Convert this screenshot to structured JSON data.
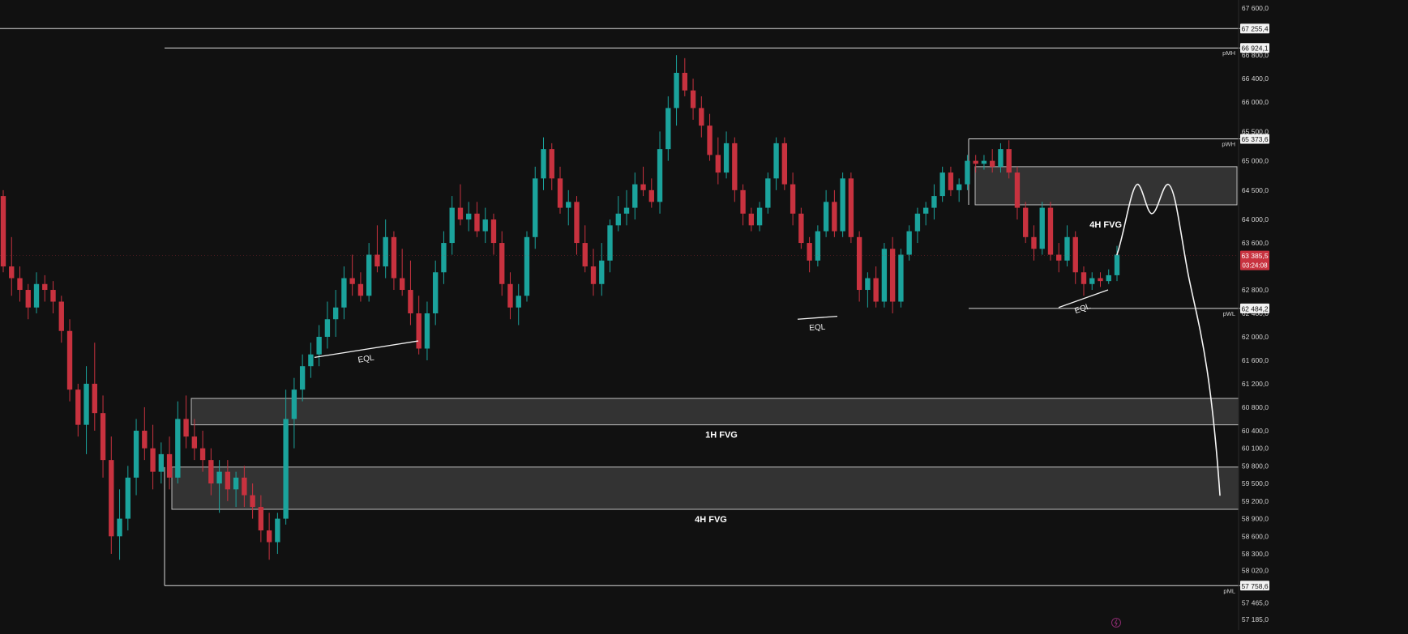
{
  "chart_data": {
    "type": "candlestick",
    "y_scale": "linear",
    "ylim": [
      57000,
      67800
    ],
    "grid": false,
    "legend": "none",
    "colors": {
      "background": "#111111",
      "up": "#1ba39c",
      "down": "#c8323f",
      "zone_fill": "#3a3a3a",
      "line": "#d8d8d8",
      "current_price": "#c8323f"
    },
    "y_ticks": [
      "67 600,0",
      "66 800,0",
      "66 400,0",
      "66 000,0",
      "65 500,0",
      "65 000,0",
      "64 500,0",
      "64 000,0",
      "63 600,0",
      "63 200,0",
      "62 800,0",
      "62 400,0",
      "62 000,0",
      "61 600,0",
      "61 200,0",
      "60 800,0",
      "60 400,0",
      "60 100,0",
      "59 800,0",
      "59 500,0",
      "59 200,0",
      "58 900,0",
      "58 600,0",
      "58 300,0",
      "58 020,0",
      "57 465,0",
      "57 185,0"
    ],
    "key_levels": [
      {
        "label": "",
        "price": 67255.4,
        "price_label": "67 255,4"
      },
      {
        "label": "pMH",
        "price": 66924.1,
        "price_label": "66 924,1"
      },
      {
        "label": "pWH",
        "price": 65373.6,
        "price_label": "65 373,6"
      },
      {
        "label": "pWL",
        "price": 62484.2,
        "price_label": "62 484,2"
      },
      {
        "label": "pML",
        "price": 57758.6,
        "price_label": "57 758,6"
      }
    ],
    "current_price": {
      "price": 63385.5,
      "price_label": "63 385,5",
      "countdown": "03:24:08"
    },
    "zones": [
      {
        "label": "4H FVG",
        "top": 64900,
        "bottom": 64250
      },
      {
        "label": "1H FVG",
        "top": 60950,
        "bottom": 60500
      },
      {
        "label": "4H FVG",
        "top": 59780,
        "bottom": 59060
      }
    ],
    "equal_lows": [
      {
        "label": "EQL",
        "from": 61650,
        "to": 61930
      },
      {
        "label": "EQL",
        "from": 62300,
        "to": 62350
      },
      {
        "label": "EQL",
        "from": 62500,
        "to": 62800
      }
    ],
    "candles": [
      [
        64400,
        64500,
        63100,
        63200
      ],
      [
        63200,
        63700,
        62700,
        63000
      ],
      [
        63000,
        63200,
        62600,
        62800
      ],
      [
        62800,
        62900,
        62300,
        62500
      ],
      [
        62500,
        63100,
        62400,
        62900
      ],
      [
        62900,
        63050,
        62600,
        62800
      ],
      [
        62800,
        62950,
        62400,
        62600
      ],
      [
        62600,
        62700,
        61900,
        62100
      ],
      [
        62100,
        62300,
        60900,
        61100
      ],
      [
        61100,
        61200,
        60300,
        60500
      ],
      [
        60500,
        61500,
        60000,
        61200
      ],
      [
        61200,
        61900,
        60400,
        60700
      ],
      [
        60700,
        61000,
        59600,
        59900
      ],
      [
        59900,
        60300,
        58300,
        58600
      ],
      [
        58600,
        59400,
        58200,
        58900
      ],
      [
        58900,
        59800,
        58700,
        59600
      ],
      [
        59600,
        60600,
        59300,
        60400
      ],
      [
        60400,
        60800,
        59900,
        60100
      ],
      [
        60100,
        60500,
        59400,
        59700
      ],
      [
        59700,
        60200,
        59500,
        60000
      ],
      [
        60000,
        60300,
        59400,
        59600
      ],
      [
        59600,
        60900,
        59500,
        60600
      ],
      [
        60600,
        61000,
        60100,
        60300
      ],
      [
        60300,
        60600,
        59900,
        60100
      ],
      [
        60100,
        60400,
        59700,
        59900
      ],
      [
        59900,
        60100,
        59300,
        59500
      ],
      [
        59500,
        59900,
        59000,
        59700
      ],
      [
        59700,
        59900,
        59200,
        59400
      ],
      [
        59400,
        59700,
        59100,
        59600
      ],
      [
        59600,
        59800,
        59100,
        59300
      ],
      [
        59300,
        59500,
        58900,
        59100
      ],
      [
        59100,
        59300,
        58500,
        58700
      ],
      [
        58700,
        59000,
        58200,
        58500
      ],
      [
        58500,
        59000,
        58300,
        58900
      ],
      [
        58900,
        61100,
        58800,
        60600
      ],
      [
        60600,
        61300,
        60100,
        61100
      ],
      [
        61100,
        61700,
        60900,
        61500
      ],
      [
        61500,
        61900,
        61300,
        61700
      ],
      [
        61700,
        62200,
        61500,
        62000
      ],
      [
        62000,
        62600,
        61800,
        62300
      ],
      [
        62300,
        62800,
        62000,
        62500
      ],
      [
        62500,
        63200,
        62300,
        63000
      ],
      [
        63000,
        63400,
        62700,
        62900
      ],
      [
        62900,
        63100,
        62600,
        62700
      ],
      [
        62700,
        63600,
        62600,
        63400
      ],
      [
        63400,
        63900,
        63100,
        63200
      ],
      [
        63200,
        64000,
        63000,
        63700
      ],
      [
        63700,
        63800,
        62800,
        63000
      ],
      [
        63000,
        63500,
        62700,
        62800
      ],
      [
        62800,
        63300,
        62200,
        62400
      ],
      [
        62400,
        62700,
        61700,
        61800
      ],
      [
        61800,
        62600,
        61600,
        62400
      ],
      [
        62400,
        63300,
        62200,
        63100
      ],
      [
        63100,
        63800,
        62900,
        63600
      ],
      [
        63600,
        64400,
        63400,
        64200
      ],
      [
        64200,
        64600,
        63900,
        64000
      ],
      [
        64000,
        64300,
        63800,
        64100
      ],
      [
        64100,
        64300,
        63700,
        63800
      ],
      [
        63800,
        64200,
        63600,
        64000
      ],
      [
        64000,
        64100,
        63400,
        63600
      ],
      [
        63600,
        63800,
        62700,
        62900
      ],
      [
        62900,
        63100,
        62300,
        62500
      ],
      [
        62500,
        62900,
        62200,
        62700
      ],
      [
        62700,
        63800,
        62600,
        63700
      ],
      [
        63700,
        64900,
        63500,
        64700
      ],
      [
        64700,
        65400,
        64500,
        65200
      ],
      [
        65200,
        65300,
        64500,
        64700
      ],
      [
        64700,
        64900,
        64100,
        64200
      ],
      [
        64200,
        64500,
        63900,
        64300
      ],
      [
        64300,
        64400,
        63400,
        63600
      ],
      [
        63600,
        63900,
        63100,
        63200
      ],
      [
        63200,
        63500,
        62700,
        62900
      ],
      [
        62900,
        63600,
        62700,
        63300
      ],
      [
        63300,
        64000,
        63100,
        63900
      ],
      [
        63900,
        64400,
        63800,
        64100
      ],
      [
        64100,
        64500,
        63900,
        64200
      ],
      [
        64200,
        64800,
        64000,
        64600
      ],
      [
        64600,
        64900,
        64400,
        64500
      ],
      [
        64500,
        64700,
        64200,
        64300
      ],
      [
        64300,
        65500,
        64100,
        65200
      ],
      [
        65200,
        66100,
        65000,
        65900
      ],
      [
        65900,
        66800,
        65600,
        66500
      ],
      [
        66500,
        66750,
        66100,
        66200
      ],
      [
        66200,
        66400,
        65700,
        65900
      ],
      [
        65900,
        66100,
        65400,
        65600
      ],
      [
        65600,
        65800,
        65000,
        65100
      ],
      [
        65100,
        65400,
        64600,
        64800
      ],
      [
        64800,
        65500,
        64700,
        65300
      ],
      [
        65300,
        65400,
        64300,
        64500
      ],
      [
        64500,
        64600,
        63900,
        64100
      ],
      [
        64100,
        64200,
        63800,
        63900
      ],
      [
        63900,
        64300,
        63800,
        64200
      ],
      [
        64200,
        64800,
        64100,
        64700
      ],
      [
        64700,
        65400,
        64500,
        65300
      ],
      [
        65300,
        65400,
        64500,
        64600
      ],
      [
        64600,
        64800,
        63900,
        64100
      ],
      [
        64100,
        64200,
        63500,
        63600
      ],
      [
        63600,
        63700,
        63100,
        63300
      ],
      [
        63300,
        63900,
        63200,
        63800
      ],
      [
        63800,
        64500,
        63700,
        64300
      ],
      [
        64300,
        64500,
        63700,
        63800
      ],
      [
        63800,
        64800,
        63700,
        64700
      ],
      [
        64700,
        64800,
        63600,
        63700
      ],
      [
        63700,
        63800,
        62600,
        62800
      ],
      [
        62800,
        63100,
        62500,
        63000
      ],
      [
        63000,
        63200,
        62500,
        62600
      ],
      [
        62600,
        63600,
        62500,
        63500
      ],
      [
        63500,
        63700,
        62400,
        62600
      ],
      [
        62600,
        63500,
        62500,
        63400
      ],
      [
        63400,
        63900,
        63300,
        63800
      ],
      [
        63800,
        64200,
        63600,
        64100
      ],
      [
        64100,
        64300,
        63900,
        64200
      ],
      [
        64200,
        64600,
        64000,
        64400
      ],
      [
        64400,
        64900,
        64300,
        64800
      ],
      [
        64800,
        64900,
        64400,
        64500
      ],
      [
        64500,
        64700,
        64300,
        64600
      ],
      [
        64600,
        65100,
        64500,
        65000
      ],
      [
        65000,
        65100,
        64800,
        64950
      ],
      [
        64950,
        65100,
        64850,
        65000
      ],
      [
        65000,
        65200,
        64800,
        64900
      ],
      [
        64900,
        65300,
        64800,
        65200
      ],
      [
        65200,
        65350,
        64700,
        64800
      ],
      [
        64800,
        64900,
        64000,
        64200
      ],
      [
        64200,
        64300,
        63600,
        63700
      ],
      [
        63700,
        63900,
        63300,
        63500
      ],
      [
        63500,
        64300,
        63400,
        64200
      ],
      [
        64200,
        64300,
        63300,
        63400
      ],
      [
        63400,
        63600,
        63100,
        63300
      ],
      [
        63300,
        63900,
        63200,
        63700
      ],
      [
        63700,
        63800,
        62900,
        63100
      ],
      [
        63100,
        63200,
        62700,
        62900
      ],
      [
        62900,
        63100,
        62800,
        63000
      ],
      [
        63000,
        63100,
        62850,
        62950
      ],
      [
        62950,
        63150,
        62900,
        63050
      ],
      [
        63050,
        63550,
        62950,
        63400
      ]
    ],
    "projection": {
      "type": "line",
      "values": [
        63400,
        64600,
        64100,
        64600,
        62500,
        59300
      ]
    }
  }
}
